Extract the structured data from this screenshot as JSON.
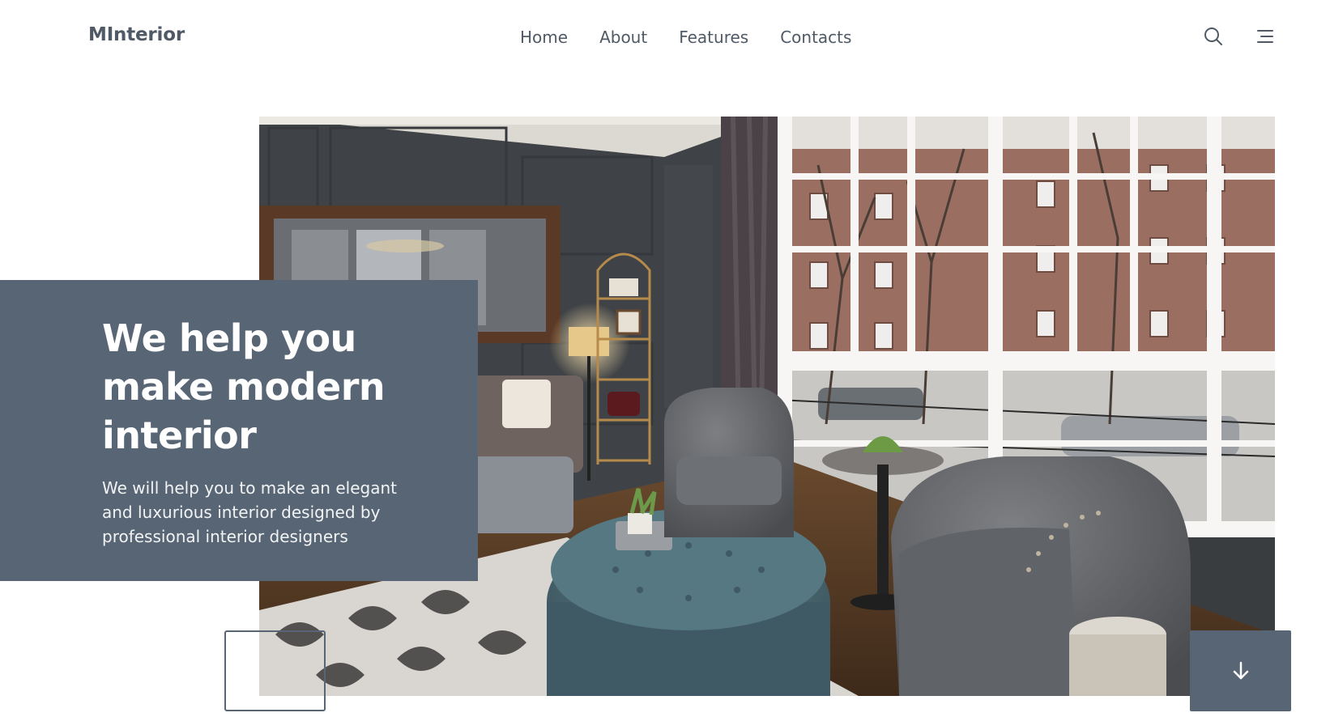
{
  "header": {
    "logo": "MInterior",
    "nav": [
      {
        "label": "Home"
      },
      {
        "label": "About"
      },
      {
        "label": "Features"
      },
      {
        "label": "Contacts"
      }
    ],
    "icons": [
      "search-icon",
      "menu-icon"
    ]
  },
  "hero": {
    "heading": "We help you make modern interior",
    "description": "We will help you to make an elegant and luxurious interior designed by professional interior designers",
    "scroll_icon": "arrow-down-icon"
  },
  "colors": {
    "accent": "#586574",
    "text": "#4f5a66",
    "background": "#ffffff"
  }
}
